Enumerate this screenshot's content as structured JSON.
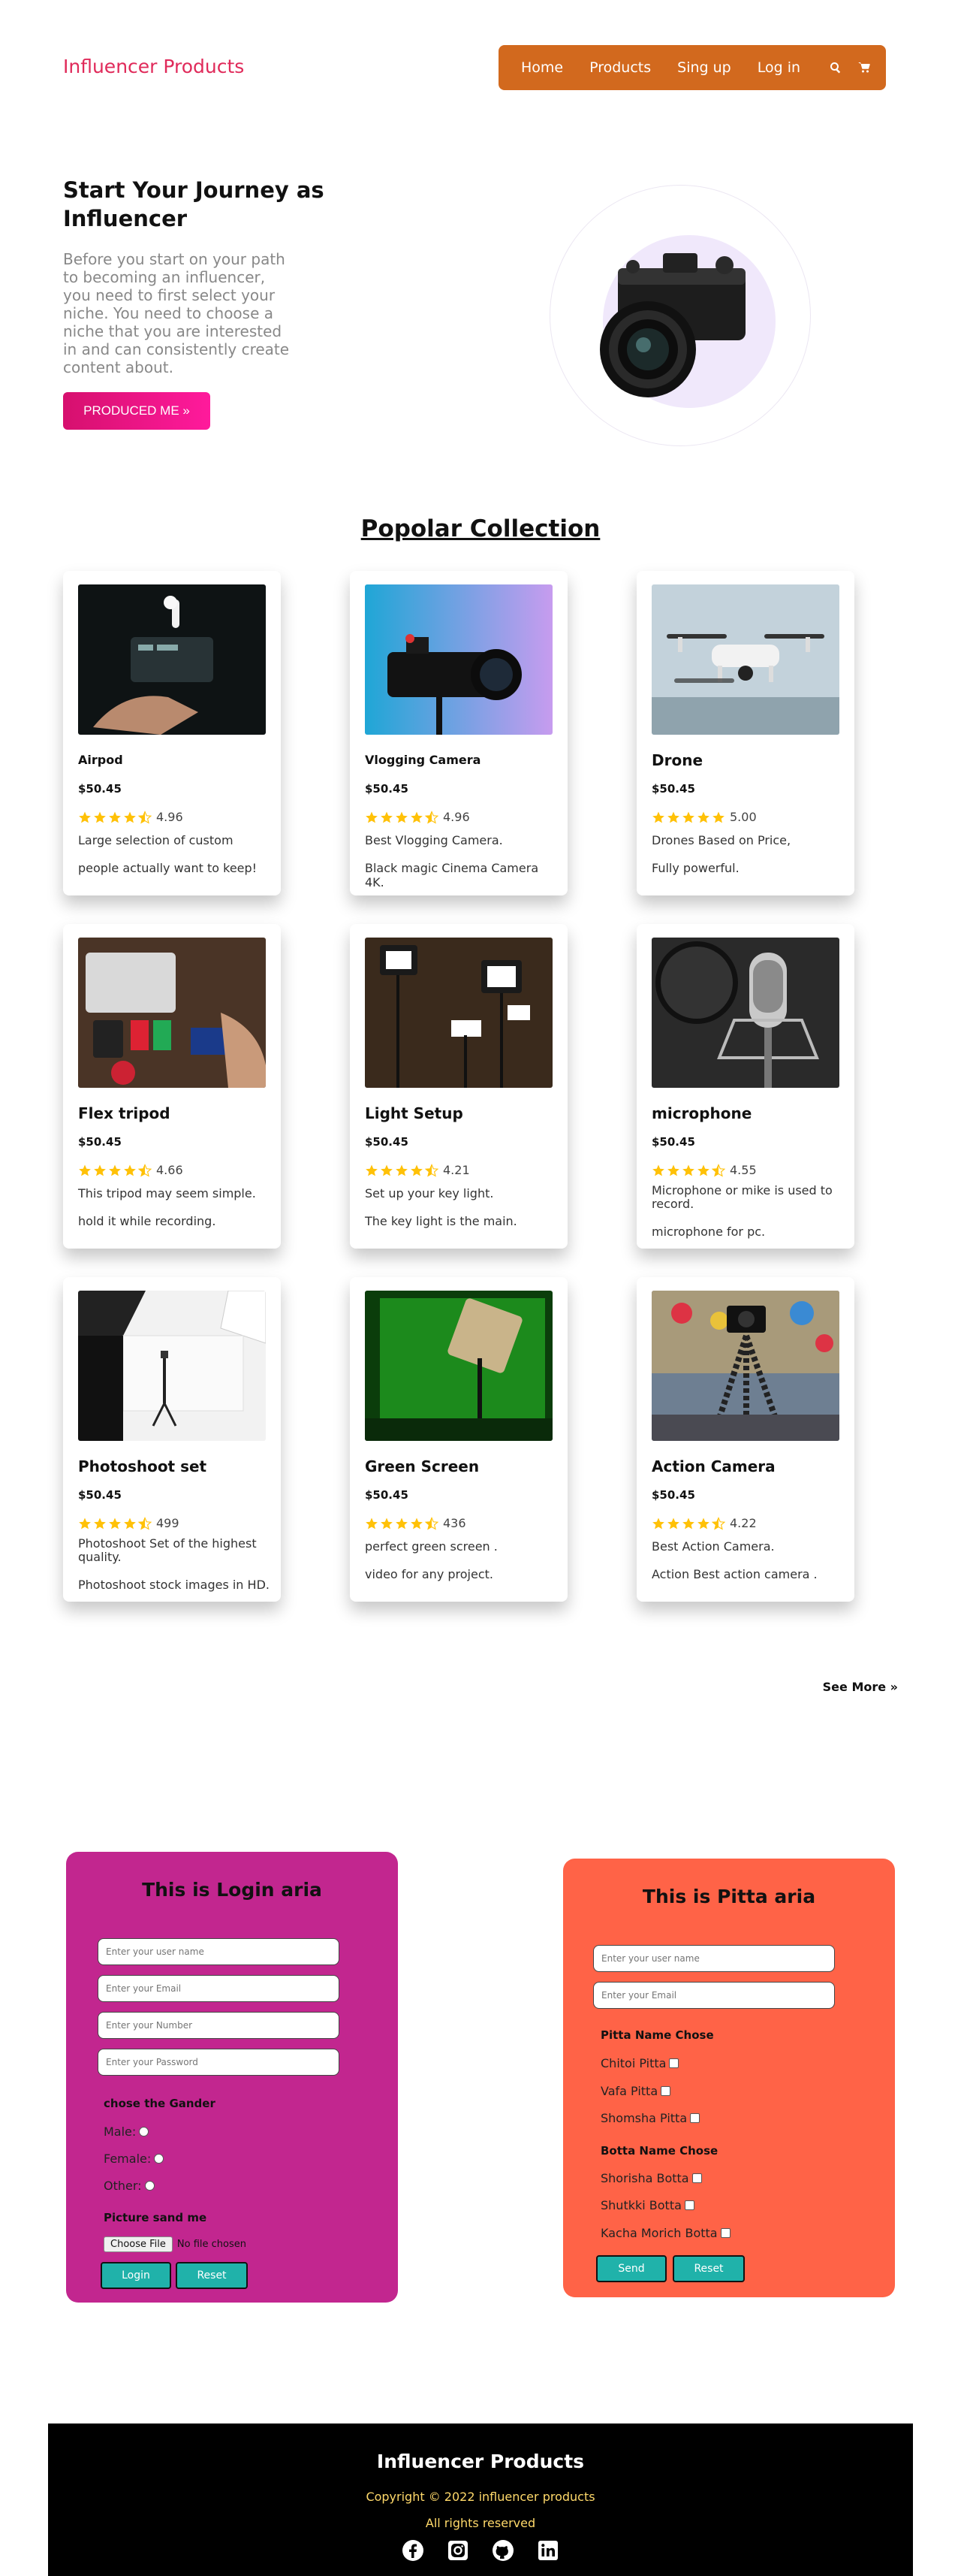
{
  "header": {
    "brand": "Influencer Products",
    "nav": [
      "Home",
      "Products",
      "Sing up",
      "Log in"
    ],
    "icons": [
      "search-icon",
      "cart-icon"
    ]
  },
  "hero": {
    "title": "Start Your Journey as Influencer",
    "text": "Before you start on your path to becoming an influencer, you need to first select your niche. You need to choose a niche that you are interested in and can consistently create content about.",
    "button": "PRODUCED ME »",
    "image": "camera"
  },
  "collection": {
    "title": "Popolar Collection",
    "cards": [
      {
        "name": "Airpod",
        "price": "$50.45",
        "rating": "4.96",
        "desc": "Large selection of custom",
        "desc2": "people actually want to keep!"
      },
      {
        "name": "Vlogging Camera",
        "price": "$50.45",
        "rating": "4.96",
        "desc": "Best Vlogging Camera.",
        "desc2": "Black magic Cinema Camera 4K."
      },
      {
        "name": "Drone",
        "price": "$50.45",
        "rating": "5.00",
        "desc": "Drones Based on Price,",
        "desc2": "Fully powerful."
      },
      {
        "name": "Flex tripod",
        "price": "$50.45",
        "rating": "4.66",
        "desc": "This tripod may seem simple.",
        "desc2": "hold it while recording."
      },
      {
        "name": "Light Setup",
        "price": "$50.45",
        "rating": "4.21",
        "desc": "Set up your key light.",
        "desc2": "The key light is the main."
      },
      {
        "name": "microphone",
        "price": "$50.45",
        "rating": "4.55",
        "desc": "Microphone or mike is used to record.",
        "desc2": "microphone for pc."
      },
      {
        "name": "Photoshoot set",
        "price": "$50.45",
        "rating": "499",
        "desc": "Photoshoot Set of the highest quality.",
        "desc2": "Photoshoot stock images in HD."
      },
      {
        "name": "Green Screen",
        "price": "$50.45",
        "rating": "436",
        "desc": "perfect green screen .",
        "desc2": "video for any project."
      },
      {
        "name": "Action Camera",
        "price": "$50.45",
        "rating": "4.22",
        "desc": "Best Action Camera.",
        "desc2": "Action Best action camera ."
      }
    ],
    "see_more": "See More »"
  },
  "login": {
    "title": "This is Login aria",
    "placeholders": [
      "Enter your user name",
      "Enter your Email",
      "Enter your Number",
      "Enter your Password"
    ],
    "gender_label": "chose the Gander",
    "genders": [
      "Male:",
      "Female:",
      "Other:"
    ],
    "picture_label": "Picture sand me",
    "file_button": "Choose File",
    "file_status": "No file chosen",
    "buttons": [
      "Login",
      "Reset"
    ]
  },
  "pitta": {
    "title": "This is Pitta aria",
    "placeholders": [
      "Enter your user name",
      "Enter your Email"
    ],
    "pitta_label": "Pitta Name Chose",
    "pittas": [
      "Chitoi Pitta",
      "Vafa Pitta",
      "Shomsha Pitta"
    ],
    "botta_label": "Botta Name Chose",
    "bottas": [
      "Shorisha Botta",
      "Shutkki Botta",
      "Kacha Morich Botta"
    ],
    "buttons": [
      "Send",
      "Reset"
    ]
  },
  "footer": {
    "title": "Influencer Products",
    "copyright": "Copyright © 2022 influencer products",
    "rights": "All rights reserved",
    "socials": [
      "facebook-icon",
      "instagram-icon",
      "github-icon",
      "linkedin-icon"
    ]
  },
  "colors": {
    "nav": "#d2691e",
    "brand": "#e02a5a",
    "login_panel": "#c2268f",
    "pitta_panel": "#ff6347",
    "button_teal": "#20b2aa",
    "star": "#ffc107"
  }
}
